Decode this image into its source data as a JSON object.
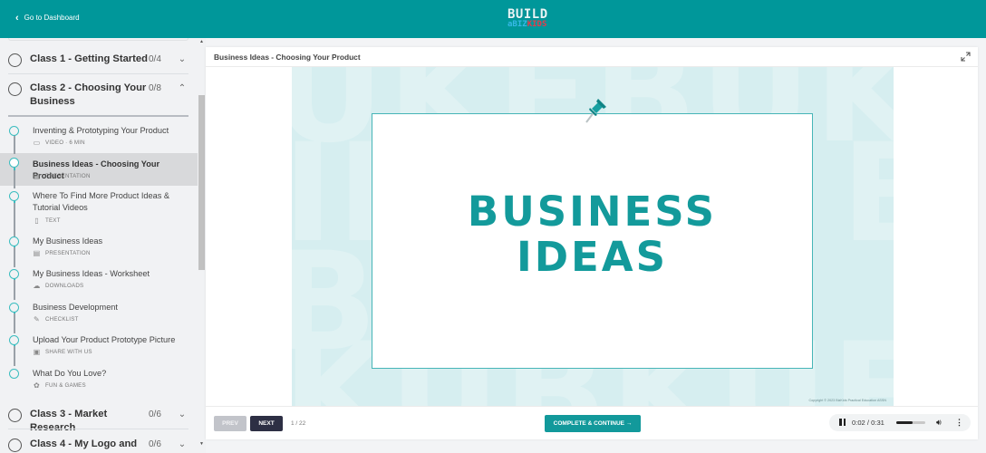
{
  "topbar": {
    "back_label": "Go to Dashboard",
    "back_icon": "chevron-left-icon",
    "logo": {
      "line1": "BUILD",
      "biz": "aBIZ",
      "kids": "KIDS"
    },
    "brand_color": "#00979a"
  },
  "sidebar": {
    "classes_top": [
      {
        "title": "Class 1 - Getting Started",
        "count": "0/4",
        "toggle": "⌄",
        "expanded": false
      },
      {
        "title": "Class 2 - Choosing Your Business",
        "count": "0/8",
        "toggle": "⌃",
        "expanded": true
      }
    ],
    "lessons": [
      {
        "title": "Inventing & Prototyping Your Product",
        "type": "VIDEO · 6 MIN",
        "icon": "video-icon",
        "active": false
      },
      {
        "title": "Business Ideas - Choosing Your Product",
        "type": "PRESENTATION",
        "icon": "presentation-icon",
        "active": true
      },
      {
        "title": "Where To Find More Product Ideas & Tutorial Videos",
        "type": "TEXT",
        "icon": "text-document-icon",
        "active": false
      },
      {
        "title": "My Business Ideas",
        "type": "PRESENTATION",
        "icon": "presentation-icon",
        "active": false
      },
      {
        "title": "My Business Ideas - Worksheet",
        "type": "DOWNLOADS",
        "icon": "cloud-download-icon",
        "active": false
      },
      {
        "title": "Business Development",
        "type": "CHECKLIST",
        "icon": "checklist-icon",
        "active": false
      },
      {
        "title": "Upload Your Product Prototype Picture",
        "type": "SHARE WITH US",
        "icon": "image-upload-icon",
        "active": false
      },
      {
        "title": "What Do You Love?",
        "type": "FUN & GAMES",
        "icon": "games-icon",
        "active": false
      }
    ],
    "classes_bottom": [
      {
        "title": "Class 3 - Market Research",
        "count": "0/6",
        "toggle": "⌄"
      },
      {
        "title": "Class 4 - My Logo and",
        "count": "0/6",
        "toggle": "⌄"
      }
    ]
  },
  "main": {
    "title": "Business Ideas - Choosing Your Product",
    "slide": {
      "headline_line1": "BUSINESS",
      "headline_line2": "IDEAS",
      "copyright": "Copyright © 2023 BizKids Practical Education ASSN",
      "accent_color": "#139a9b"
    },
    "footer": {
      "prev_label": "PREV",
      "next_label": "NEXT",
      "page_indicator": "1 / 22",
      "complete_label": "COMPLETE & CONTINUE →",
      "audio": {
        "time": "0:02 / 0:31",
        "progress_fraction": 0.55
      }
    }
  }
}
